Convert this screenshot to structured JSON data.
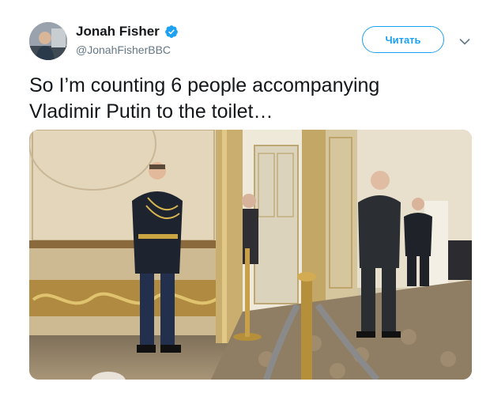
{
  "tweet": {
    "author": {
      "display_name": "Jonah Fisher",
      "handle": "@JonahFisherBBC",
      "verified_icon": "verified-badge-icon",
      "avatar_icon": "avatar"
    },
    "follow_label": "Читать",
    "more_icon": "chevron-down-icon",
    "text_line1": "So I’m counting 6 people accompanying",
    "text_line2": "Vladimir Putin to the toilet…",
    "media_icon": "video-thumbnail"
  },
  "colors": {
    "accent": "#1da1f2",
    "text": "#14171a",
    "secondary": "#657786"
  }
}
